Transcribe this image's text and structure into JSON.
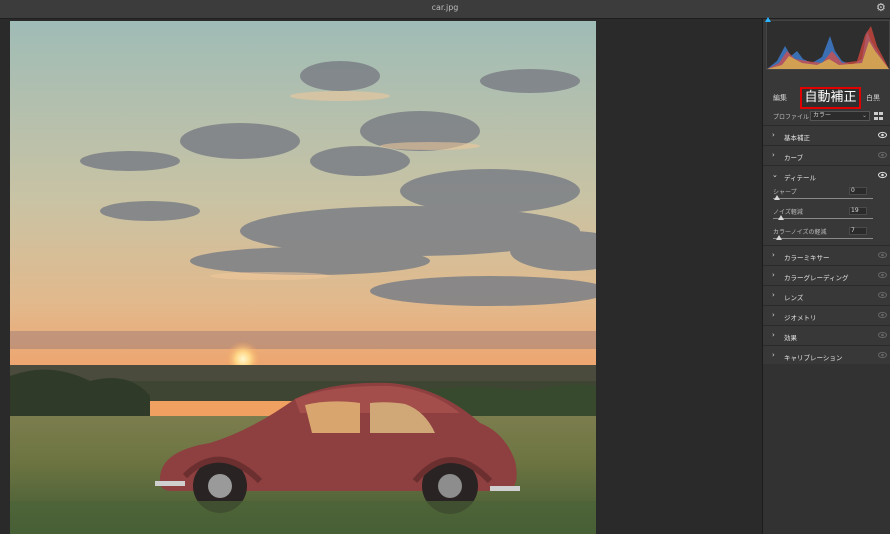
{
  "window": {
    "title": "car.jpg"
  },
  "panel": {
    "tabs": {
      "edit": "編集",
      "auto": "自動補正",
      "bw": "白黒"
    },
    "profile": {
      "label": "プロファイル",
      "value": "カラー"
    },
    "sections": [
      {
        "label": "基本補正",
        "expanded": false
      },
      {
        "label": "カーブ",
        "expanded": false
      },
      {
        "label": "ディテール",
        "expanded": true
      },
      {
        "label": "カラーミキサー",
        "expanded": false
      },
      {
        "label": "カラーグレーディング",
        "expanded": false
      },
      {
        "label": "レンズ",
        "expanded": false
      },
      {
        "label": "ジオメトリ",
        "expanded": false
      },
      {
        "label": "効果",
        "expanded": false
      },
      {
        "label": "キャリブレーション",
        "expanded": false
      }
    ],
    "detail_sliders": [
      {
        "label": "シャープ",
        "value": "0"
      },
      {
        "label": "ノイズ軽減",
        "value": "19"
      },
      {
        "label": "カラーノイズの軽減",
        "value": "7"
      }
    ]
  },
  "colors": {
    "highlight": "#e00000",
    "panel_bg": "#383838",
    "accent": "#2ab7ff"
  }
}
